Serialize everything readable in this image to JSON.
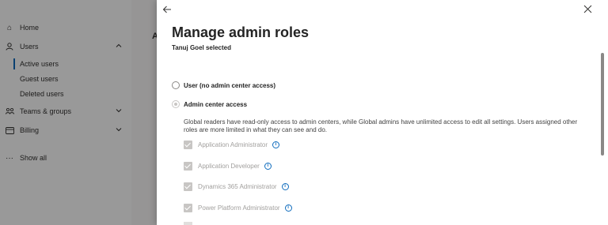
{
  "nav": {
    "home": "Home",
    "users": "Users",
    "active_users": "Active users",
    "guest_users": "Guest users",
    "deleted_users": "Deleted users",
    "teams_groups": "Teams & groups",
    "billing": "Billing",
    "show_all": "Show all"
  },
  "background": {
    "letter": "A"
  },
  "panel": {
    "title": "Manage admin roles",
    "subtitle": "Tanuj Goel selected",
    "radio_no_access": "User (no admin center access)",
    "radio_admin_access": "Admin center access",
    "selected_option": "Admin center access",
    "description": "Global readers have read-only access to admin centers, while Global admins have unlimited access to edit all settings. Users assigned other roles are more limited in what they can see and do.",
    "roles": [
      {
        "label": "Application Administrator",
        "checked": true,
        "disabled": true
      },
      {
        "label": "Application Developer",
        "checked": true,
        "disabled": true
      },
      {
        "label": "Dynamics 365 Administrator",
        "checked": true,
        "disabled": true
      },
      {
        "label": "Power Platform Administrator",
        "checked": true,
        "disabled": true
      }
    ]
  },
  "icons": {
    "back": "arrow-left-icon",
    "close": "close-icon",
    "info": "info-icon"
  },
  "colors": {
    "accent": "#0f6cbd",
    "overlay": "rgba(0,0,0,0.40)",
    "disabled": "#c8c6c4"
  }
}
